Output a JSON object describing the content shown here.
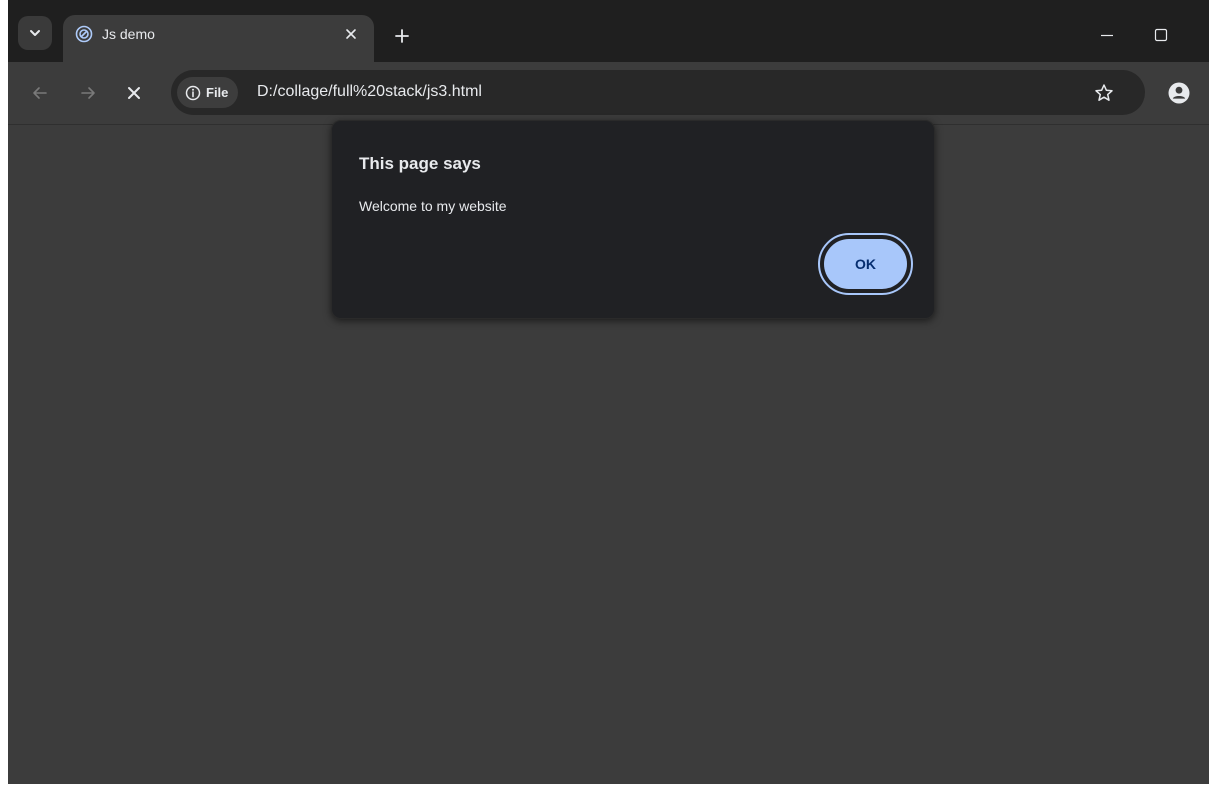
{
  "tab": {
    "title": "Js demo"
  },
  "toolbar": {
    "site_chip_label": "File",
    "url": "D:/collage/full%20stack/js3.html"
  },
  "dialog": {
    "title": "This page says",
    "message": "Welcome to my website",
    "ok_label": "OK"
  },
  "icons": {
    "tab_search": "chevron-down-icon",
    "favicon": "globe-favicon-icon",
    "tab_close": "close-icon",
    "new_tab": "plus-icon",
    "minimize": "minimize-icon",
    "maximize": "maximize-icon",
    "back": "arrow-left-icon",
    "forward": "arrow-right-icon",
    "stop": "close-icon",
    "site_info": "info-icon",
    "bookmark": "star-icon",
    "profile": "person-icon"
  },
  "colors": {
    "tabstrip_bg": "#1f1f1f",
    "toolbar_bg": "#3c3c3c",
    "omnibox_bg": "#282828",
    "dialog_bg": "#202124",
    "page_bg": "#3c3c3c",
    "ok_button_bg": "#a8c7fa",
    "ok_button_text": "#062e6f",
    "text_primary": "#e8eaed"
  }
}
